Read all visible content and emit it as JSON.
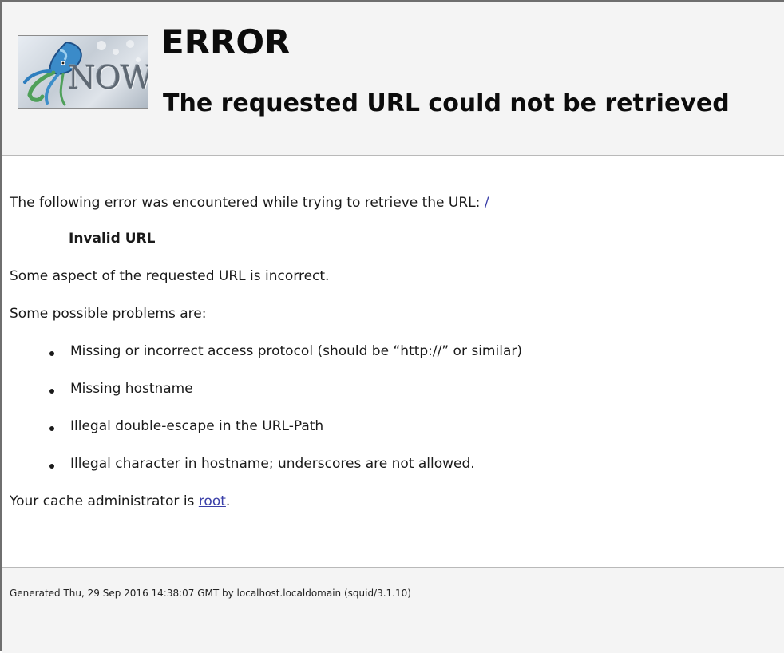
{
  "header": {
    "logo_text": "NOW",
    "title": "ERROR",
    "subtitle": "The requested URL could not be retrieved"
  },
  "content": {
    "intro": "The following error was encountered while trying to retrieve the URL: ",
    "url_link": "/",
    "error_title": "Invalid URL",
    "description": "Some aspect of the requested URL is incorrect.",
    "problems_intro": "Some possible problems are:",
    "problems": [
      "Missing or incorrect access protocol (should be “http://” or similar)",
      "Missing hostname",
      "Illegal double-escape in the URL-Path",
      "Illegal character in hostname; underscores are not allowed."
    ],
    "admin_prefix": "Your cache administrator is ",
    "admin_link": "root",
    "admin_suffix": "."
  },
  "footer": {
    "generated": "Generated Thu, 29 Sep 2016 14:38:07 GMT by localhost.localdomain (squid/3.1.10)"
  },
  "colors": {
    "header_bg": "#f4f4f4",
    "link": "#3a3fa8",
    "rule": "#b9b9b9"
  }
}
